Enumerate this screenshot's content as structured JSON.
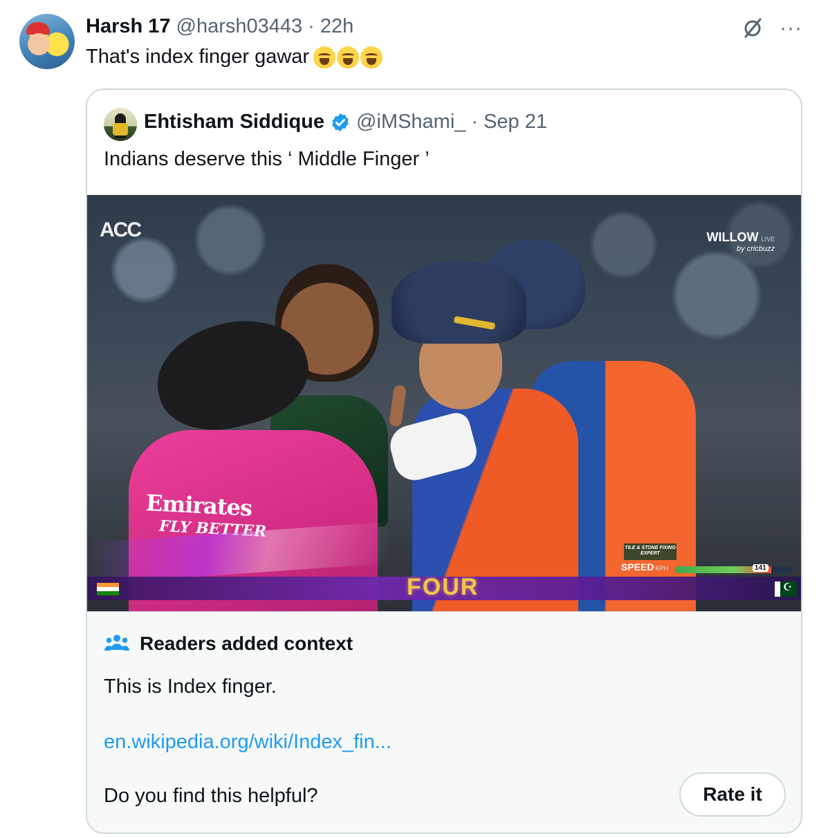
{
  "tweet": {
    "display_name": "Harsh 17",
    "handle": "@harsh03443",
    "separator": "·",
    "time": "22h",
    "text": "That's index finger gawar",
    "emojis": [
      "loudly-crying-face",
      "loudly-crying-face",
      "loudly-crying-face"
    ],
    "icons": {
      "grok": "grok-icon",
      "more": "more-icon"
    },
    "more_label": "···"
  },
  "quote": {
    "display_name": "Ehtisham Siddique",
    "verified": true,
    "handle": "@iMShami_",
    "separator": "·",
    "date": "Sep 21",
    "text": "Indians deserve this ‘ Middle Finger ’"
  },
  "media": {
    "acc_logo": "ACC",
    "willow_logo": "WILLOW",
    "willow_live": "LIVE",
    "willow_sub": "by cricbuzz",
    "umpire_sponsor": "Emirates",
    "umpire_sponsor_tagline": "FLY BETTER",
    "scorebar_event": "FOUR",
    "sponsor_box": "TILE & STONE FIXING EXPERT",
    "speed_label": "SPEED",
    "speed_unit": "KPH",
    "speed_value": "141",
    "speed_fraction": 0.82
  },
  "community_note": {
    "title": "Readers added context",
    "body": "This is Index finger.",
    "link": "en.wikipedia.org/wiki/Index_fin...",
    "helpful_question": "Do you find this helpful?",
    "rate_button": "Rate it"
  },
  "colors": {
    "link": "#1d9bf0",
    "verified": "#1d9bf0",
    "secondary_text": "#536471",
    "border": "#cfd9de",
    "note_background": "#f7f9f9"
  }
}
